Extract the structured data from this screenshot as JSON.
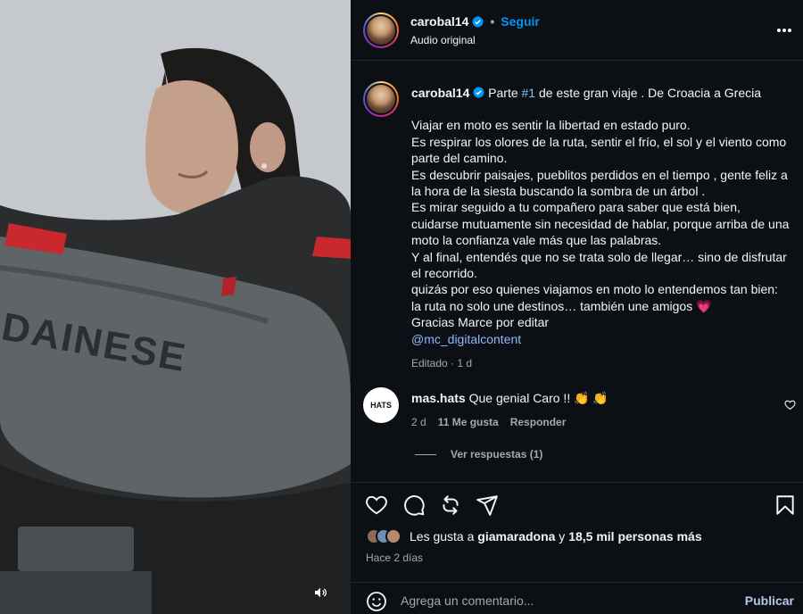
{
  "header": {
    "username": "carobal14",
    "separator": "•",
    "follow_label": "Seguir",
    "audio_label": "Audio original"
  },
  "caption": {
    "username": "carobal14",
    "first_line_pre": "Parte ",
    "hashtag": "#1",
    "first_line_post": " de este gran viaje . De Croacia a Grecia",
    "lines": [
      "Viajar en moto es sentir la libertad en estado puro.",
      "Es respirar los olores de la ruta, sentir el frío, el sol y el viento como parte del camino.",
      "Es descubrir paisajes, pueblitos perdidos en el tiempo , gente feliz a la hora de la siesta buscando la sombra de un árbol .",
      "Es mirar seguido a tu compañero para saber que está bien, cuidarse mutuamente sin necesidad de hablar, porque arriba de una moto la confianza vale más que las palabras.",
      "Y al final, entendés que no se trata solo de llegar… sino de disfrutar el recorrido.",
      "quizás por eso quienes viajamos en moto lo entendemos tan bien:",
      "la ruta no solo une destinos… también une amigos 💗",
      "Gracias Marce por editar"
    ],
    "mention": "@mc_digitalcontent",
    "edited": "Editado · 1 d"
  },
  "comment": {
    "username": "mas.hats",
    "text": "Que genial Caro !! 👏 👏",
    "avatar_text": "HATS",
    "age": "2 d",
    "likes": "11 Me gusta",
    "reply_label": "Responder",
    "view_replies": "Ver respuestas (1)"
  },
  "likes": {
    "prefix": "Les gusta a ",
    "user": "giamaradona",
    "suffix_pre": " y ",
    "count": "18,5 mil personas más"
  },
  "time_ago": "Hace 2 días",
  "comment_box": {
    "placeholder": "Agrega un comentario...",
    "publish_label": "Publicar"
  },
  "media": {
    "jacket_text": "DAINESE"
  },
  "colors": {
    "accent": "#0095f6",
    "background": "#0c1014",
    "muted": "#a8a8a8"
  }
}
